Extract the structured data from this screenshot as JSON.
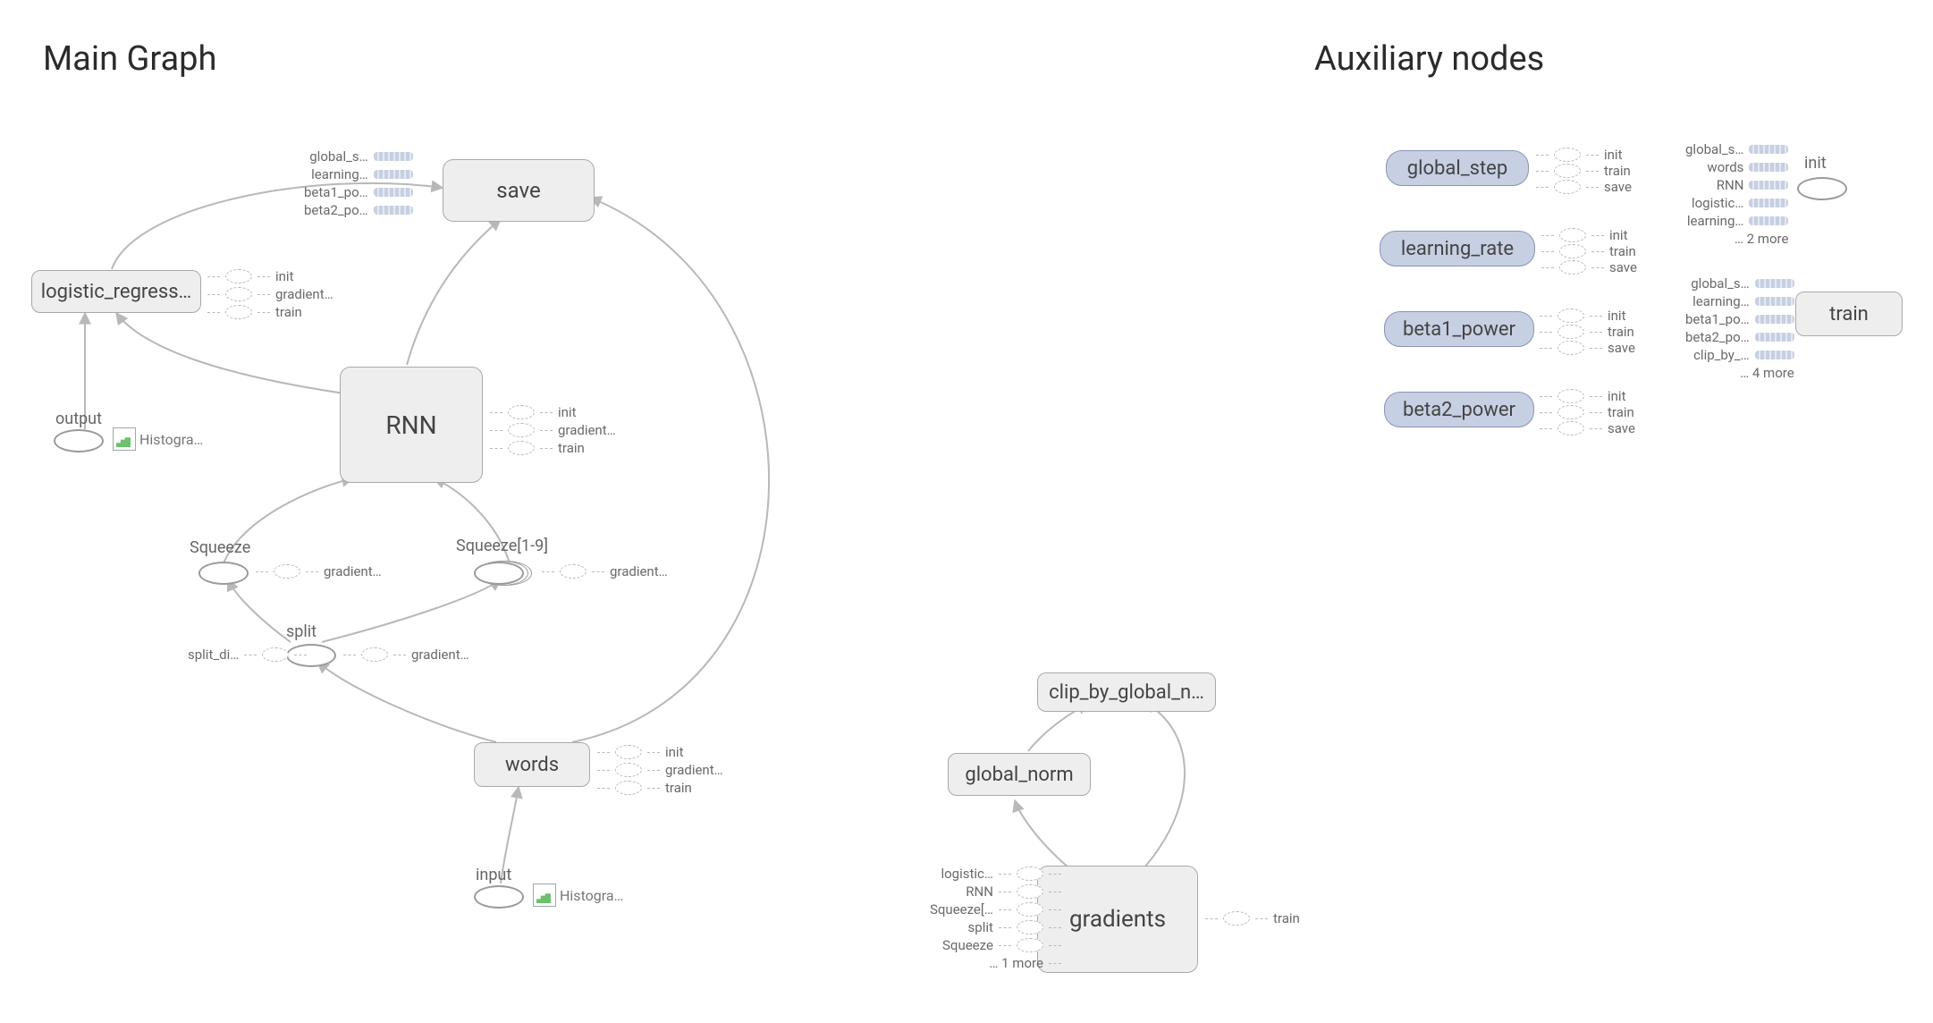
{
  "titles": {
    "main": "Main Graph",
    "aux": "Auxiliary nodes"
  },
  "main": {
    "save": "save",
    "save_inputs": [
      "global_s…",
      "learning…",
      "beta1_po…",
      "beta2_po…"
    ],
    "logreg": "logistic_regress…",
    "logreg_out": [
      "init",
      "gradient…",
      "train"
    ],
    "rnn": "RNN",
    "rnn_out": [
      "init",
      "gradient…",
      "train"
    ],
    "squeeze": "Squeeze",
    "squeeze_out": "gradient…",
    "squeeze19": "Squeeze[1-9]",
    "squeeze19_out": "gradient…",
    "split": "split",
    "split_in": "split_di…",
    "split_out": "gradient…",
    "words": "words",
    "words_out": [
      "init",
      "gradient…",
      "train"
    ],
    "output": "output",
    "input": "input",
    "histo": "Histogra…"
  },
  "grad": {
    "clip": "clip_by_global_n…",
    "gnorm": "global_norm",
    "grad": "gradients",
    "grad_in": [
      "logistic…",
      "RNN",
      "Squeeze[…",
      "split",
      "Squeeze",
      "… 1 more"
    ],
    "grad_out": "train"
  },
  "aux": {
    "vars": [
      {
        "name": "global_step",
        "out": [
          "init",
          "train",
          "save"
        ]
      },
      {
        "name": "learning_rate",
        "out": [
          "init",
          "train",
          "save"
        ]
      },
      {
        "name": "beta1_power",
        "out": [
          "init",
          "train",
          "save"
        ]
      },
      {
        "name": "beta2_power",
        "out": [
          "init",
          "train",
          "save"
        ]
      }
    ],
    "init": "init",
    "init_in": [
      "global_s…",
      "words",
      "RNN",
      "logistic…",
      "learning…",
      "… 2 more"
    ],
    "train": "train",
    "train_in": [
      "global_s…",
      "learning…",
      "beta1_po…",
      "beta2_po…",
      "clip_by_…",
      "… 4 more"
    ]
  }
}
